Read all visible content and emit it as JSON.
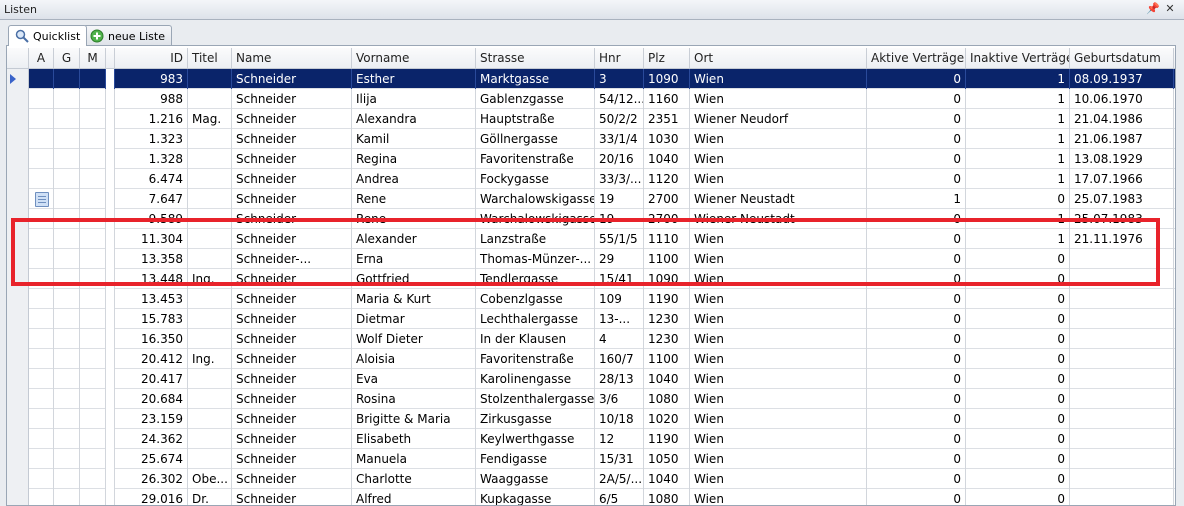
{
  "window": {
    "title": "Listen",
    "pin_icon": "pin-icon",
    "close_icon": "close-icon"
  },
  "tabs": [
    {
      "label": "Quicklist",
      "icon": "search-icon",
      "active": true
    },
    {
      "label": "neue Liste",
      "icon": "add-icon",
      "active": false
    }
  ],
  "columns": [
    {
      "key": "a",
      "label": "A"
    },
    {
      "key": "g",
      "label": "G"
    },
    {
      "key": "m",
      "label": "M"
    },
    {
      "key": "id",
      "label": "ID"
    },
    {
      "key": "titel",
      "label": "Titel"
    },
    {
      "key": "name",
      "label": "Name"
    },
    {
      "key": "vorname",
      "label": "Vorname"
    },
    {
      "key": "strasse",
      "label": "Strasse"
    },
    {
      "key": "hnr",
      "label": "Hnr"
    },
    {
      "key": "plz",
      "label": "Plz"
    },
    {
      "key": "ort",
      "label": "Ort"
    },
    {
      "key": "aktiv",
      "label": "Aktive Verträge"
    },
    {
      "key": "inaktiv",
      "label": "Inaktive Verträge"
    },
    {
      "key": "geb",
      "label": "Geburtsdatum"
    }
  ],
  "rows": [
    {
      "selected": true,
      "note": false,
      "id": "983",
      "titel": "",
      "name": "Schneider",
      "vorname": "Esther",
      "strasse": "Marktgasse",
      "hnr": "3",
      "plz": "1090",
      "ort": "Wien",
      "aktiv": "0",
      "inaktiv": "1",
      "geb": "08.09.1937"
    },
    {
      "selected": false,
      "note": false,
      "id": "988",
      "titel": "",
      "name": "Schneider",
      "vorname": "Ilija",
      "strasse": "Gablenzgasse",
      "hnr": "54/12...",
      "plz": "1160",
      "ort": "Wien",
      "aktiv": "0",
      "inaktiv": "1",
      "geb": "10.06.1970"
    },
    {
      "selected": false,
      "note": false,
      "id": "1.216",
      "titel": "Mag.",
      "name": "Schneider",
      "vorname": "Alexandra",
      "strasse": "Hauptstraße",
      "hnr": "50/2/2",
      "plz": "2351",
      "ort": "Wiener Neudorf",
      "aktiv": "0",
      "inaktiv": "1",
      "geb": "21.04.1986"
    },
    {
      "selected": false,
      "note": false,
      "id": "1.323",
      "titel": "",
      "name": "Schneider",
      "vorname": "Kamil",
      "strasse": "Göllnergasse",
      "hnr": "33/1/4",
      "plz": "1030",
      "ort": "Wien",
      "aktiv": "0",
      "inaktiv": "1",
      "geb": "21.06.1987"
    },
    {
      "selected": false,
      "note": false,
      "id": "1.328",
      "titel": "",
      "name": "Schneider",
      "vorname": "Regina",
      "strasse": "Favoritenstraße",
      "hnr": "20/16",
      "plz": "1040",
      "ort": "Wien",
      "aktiv": "0",
      "inaktiv": "1",
      "geb": "13.08.1929"
    },
    {
      "selected": false,
      "note": false,
      "id": "6.474",
      "titel": "",
      "name": "Schneider",
      "vorname": "Andrea",
      "strasse": "Fockygasse",
      "hnr": "33/3/...",
      "plz": "1120",
      "ort": "Wien",
      "aktiv": "0",
      "inaktiv": "1",
      "geb": "17.07.1966"
    },
    {
      "selected": false,
      "note": true,
      "id": "7.647",
      "titel": "",
      "name": "Schneider",
      "vorname": "Rene",
      "strasse": "Warchalowskigasse",
      "hnr": "19",
      "plz": "2700",
      "ort": "Wiener Neustadt",
      "aktiv": "1",
      "inaktiv": "0",
      "geb": "25.07.1983"
    },
    {
      "selected": false,
      "note": false,
      "id": "9.589",
      "titel": "",
      "name": "Schneider",
      "vorname": "Rene",
      "strasse": "Warchalowskigasse",
      "hnr": "19",
      "plz": "2700",
      "ort": "Wiener Neustadt",
      "aktiv": "0",
      "inaktiv": "1",
      "geb": "25.07.1983"
    },
    {
      "selected": false,
      "note": false,
      "id": "11.304",
      "titel": "",
      "name": "Schneider",
      "vorname": "Alexander",
      "strasse": "Lanzstraße",
      "hnr": "55/1/5",
      "plz": "1110",
      "ort": "Wien",
      "aktiv": "0",
      "inaktiv": "1",
      "geb": "21.11.1976"
    },
    {
      "selected": false,
      "note": false,
      "id": "13.358",
      "titel": "",
      "name": "Schneider-...",
      "vorname": "Erna",
      "strasse": "Thomas-Münzer-...",
      "hnr": "29",
      "plz": "1100",
      "ort": "Wien",
      "aktiv": "0",
      "inaktiv": "0",
      "geb": ""
    },
    {
      "selected": false,
      "note": false,
      "id": "13.448",
      "titel": "Ing.",
      "name": "Schneider",
      "vorname": "Gottfried",
      "strasse": "Tendlergasse",
      "hnr": "15/41",
      "plz": "1090",
      "ort": "Wien",
      "aktiv": "0",
      "inaktiv": "0",
      "geb": ""
    },
    {
      "selected": false,
      "note": false,
      "id": "13.453",
      "titel": "",
      "name": "Schneider",
      "vorname": "Maria & Kurt",
      "strasse": "Cobenzlgasse",
      "hnr": "109",
      "plz": "1190",
      "ort": "Wien",
      "aktiv": "0",
      "inaktiv": "0",
      "geb": ""
    },
    {
      "selected": false,
      "note": false,
      "id": "15.783",
      "titel": "",
      "name": "Schneider",
      "vorname": "Dietmar",
      "strasse": "Lechthalergasse",
      "hnr": "13-...",
      "plz": "1230",
      "ort": "Wien",
      "aktiv": "0",
      "inaktiv": "0",
      "geb": ""
    },
    {
      "selected": false,
      "note": false,
      "id": "16.350",
      "titel": "",
      "name": "Schneider",
      "vorname": "Wolf Dieter",
      "strasse": "In der Klausen",
      "hnr": "4",
      "plz": "1230",
      "ort": "Wien",
      "aktiv": "0",
      "inaktiv": "0",
      "geb": ""
    },
    {
      "selected": false,
      "note": false,
      "id": "20.412",
      "titel": "Ing.",
      "name": "Schneider",
      "vorname": "Aloisia",
      "strasse": "Favoritenstraße",
      "hnr": "160/7",
      "plz": "1100",
      "ort": "Wien",
      "aktiv": "0",
      "inaktiv": "0",
      "geb": ""
    },
    {
      "selected": false,
      "note": false,
      "id": "20.417",
      "titel": "",
      "name": "Schneider",
      "vorname": "Eva",
      "strasse": "Karolinengasse",
      "hnr": "28/13",
      "plz": "1040",
      "ort": "Wien",
      "aktiv": "0",
      "inaktiv": "0",
      "geb": ""
    },
    {
      "selected": false,
      "note": false,
      "id": "20.684",
      "titel": "",
      "name": "Schneider",
      "vorname": "Rosina",
      "strasse": "Stolzenthalergasse",
      "hnr": "3/6",
      "plz": "1080",
      "ort": "Wien",
      "aktiv": "0",
      "inaktiv": "0",
      "geb": ""
    },
    {
      "selected": false,
      "note": false,
      "id": "23.159",
      "titel": "",
      "name": "Schneider",
      "vorname": "Brigitte & Maria",
      "strasse": "Zirkusgasse",
      "hnr": "10/18",
      "plz": "1020",
      "ort": "Wien",
      "aktiv": "0",
      "inaktiv": "0",
      "geb": ""
    },
    {
      "selected": false,
      "note": false,
      "id": "24.362",
      "titel": "",
      "name": "Schneider",
      "vorname": "Elisabeth",
      "strasse": "Keylwerthgasse",
      "hnr": "12",
      "plz": "1190",
      "ort": "Wien",
      "aktiv": "0",
      "inaktiv": "0",
      "geb": ""
    },
    {
      "selected": false,
      "note": false,
      "id": "25.674",
      "titel": "",
      "name": "Schneider",
      "vorname": "Manuela",
      "strasse": "Fendigasse",
      "hnr": "15/31",
      "plz": "1050",
      "ort": "Wien",
      "aktiv": "0",
      "inaktiv": "0",
      "geb": ""
    },
    {
      "selected": false,
      "note": false,
      "id": "26.302",
      "titel": "Obe...",
      "name": "Schneider",
      "vorname": "Charlotte",
      "strasse": "Waaggasse",
      "hnr": "2A/5/...",
      "plz": "1040",
      "ort": "Wien",
      "aktiv": "0",
      "inaktiv": "0",
      "geb": ""
    },
    {
      "selected": false,
      "note": false,
      "id": "29.016",
      "titel": "Dr.",
      "name": "Schneider",
      "vorname": "Alfred",
      "strasse": "Kupkagasse",
      "hnr": "6/5",
      "plz": "1080",
      "ort": "Wien",
      "aktiv": "0",
      "inaktiv": "0",
      "geb": ""
    }
  ],
  "colors": {
    "selection": "#0a246a",
    "highlight_box": "#e8232b"
  }
}
